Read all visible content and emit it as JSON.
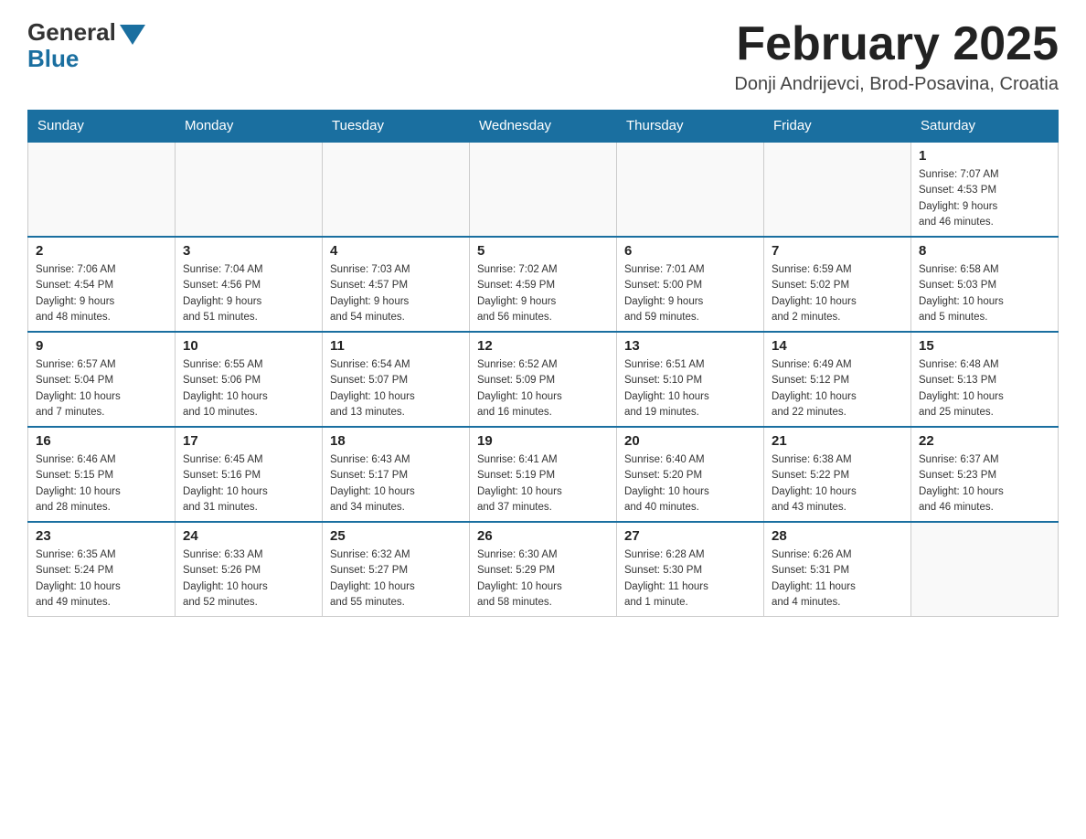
{
  "header": {
    "logo_general": "General",
    "logo_blue": "Blue",
    "title": "February 2025",
    "location": "Donji Andrijevci, Brod-Posavina, Croatia"
  },
  "weekdays": [
    "Sunday",
    "Monday",
    "Tuesday",
    "Wednesday",
    "Thursday",
    "Friday",
    "Saturday"
  ],
  "rows": [
    [
      {
        "day": "",
        "info": ""
      },
      {
        "day": "",
        "info": ""
      },
      {
        "day": "",
        "info": ""
      },
      {
        "day": "",
        "info": ""
      },
      {
        "day": "",
        "info": ""
      },
      {
        "day": "",
        "info": ""
      },
      {
        "day": "1",
        "info": "Sunrise: 7:07 AM\nSunset: 4:53 PM\nDaylight: 9 hours\nand 46 minutes."
      }
    ],
    [
      {
        "day": "2",
        "info": "Sunrise: 7:06 AM\nSunset: 4:54 PM\nDaylight: 9 hours\nand 48 minutes."
      },
      {
        "day": "3",
        "info": "Sunrise: 7:04 AM\nSunset: 4:56 PM\nDaylight: 9 hours\nand 51 minutes."
      },
      {
        "day": "4",
        "info": "Sunrise: 7:03 AM\nSunset: 4:57 PM\nDaylight: 9 hours\nand 54 minutes."
      },
      {
        "day": "5",
        "info": "Sunrise: 7:02 AM\nSunset: 4:59 PM\nDaylight: 9 hours\nand 56 minutes."
      },
      {
        "day": "6",
        "info": "Sunrise: 7:01 AM\nSunset: 5:00 PM\nDaylight: 9 hours\nand 59 minutes."
      },
      {
        "day": "7",
        "info": "Sunrise: 6:59 AM\nSunset: 5:02 PM\nDaylight: 10 hours\nand 2 minutes."
      },
      {
        "day": "8",
        "info": "Sunrise: 6:58 AM\nSunset: 5:03 PM\nDaylight: 10 hours\nand 5 minutes."
      }
    ],
    [
      {
        "day": "9",
        "info": "Sunrise: 6:57 AM\nSunset: 5:04 PM\nDaylight: 10 hours\nand 7 minutes."
      },
      {
        "day": "10",
        "info": "Sunrise: 6:55 AM\nSunset: 5:06 PM\nDaylight: 10 hours\nand 10 minutes."
      },
      {
        "day": "11",
        "info": "Sunrise: 6:54 AM\nSunset: 5:07 PM\nDaylight: 10 hours\nand 13 minutes."
      },
      {
        "day": "12",
        "info": "Sunrise: 6:52 AM\nSunset: 5:09 PM\nDaylight: 10 hours\nand 16 minutes."
      },
      {
        "day": "13",
        "info": "Sunrise: 6:51 AM\nSunset: 5:10 PM\nDaylight: 10 hours\nand 19 minutes."
      },
      {
        "day": "14",
        "info": "Sunrise: 6:49 AM\nSunset: 5:12 PM\nDaylight: 10 hours\nand 22 minutes."
      },
      {
        "day": "15",
        "info": "Sunrise: 6:48 AM\nSunset: 5:13 PM\nDaylight: 10 hours\nand 25 minutes."
      }
    ],
    [
      {
        "day": "16",
        "info": "Sunrise: 6:46 AM\nSunset: 5:15 PM\nDaylight: 10 hours\nand 28 minutes."
      },
      {
        "day": "17",
        "info": "Sunrise: 6:45 AM\nSunset: 5:16 PM\nDaylight: 10 hours\nand 31 minutes."
      },
      {
        "day": "18",
        "info": "Sunrise: 6:43 AM\nSunset: 5:17 PM\nDaylight: 10 hours\nand 34 minutes."
      },
      {
        "day": "19",
        "info": "Sunrise: 6:41 AM\nSunset: 5:19 PM\nDaylight: 10 hours\nand 37 minutes."
      },
      {
        "day": "20",
        "info": "Sunrise: 6:40 AM\nSunset: 5:20 PM\nDaylight: 10 hours\nand 40 minutes."
      },
      {
        "day": "21",
        "info": "Sunrise: 6:38 AM\nSunset: 5:22 PM\nDaylight: 10 hours\nand 43 minutes."
      },
      {
        "day": "22",
        "info": "Sunrise: 6:37 AM\nSunset: 5:23 PM\nDaylight: 10 hours\nand 46 minutes."
      }
    ],
    [
      {
        "day": "23",
        "info": "Sunrise: 6:35 AM\nSunset: 5:24 PM\nDaylight: 10 hours\nand 49 minutes."
      },
      {
        "day": "24",
        "info": "Sunrise: 6:33 AM\nSunset: 5:26 PM\nDaylight: 10 hours\nand 52 minutes."
      },
      {
        "day": "25",
        "info": "Sunrise: 6:32 AM\nSunset: 5:27 PM\nDaylight: 10 hours\nand 55 minutes."
      },
      {
        "day": "26",
        "info": "Sunrise: 6:30 AM\nSunset: 5:29 PM\nDaylight: 10 hours\nand 58 minutes."
      },
      {
        "day": "27",
        "info": "Sunrise: 6:28 AM\nSunset: 5:30 PM\nDaylight: 11 hours\nand 1 minute."
      },
      {
        "day": "28",
        "info": "Sunrise: 6:26 AM\nSunset: 5:31 PM\nDaylight: 11 hours\nand 4 minutes."
      },
      {
        "day": "",
        "info": ""
      }
    ]
  ]
}
